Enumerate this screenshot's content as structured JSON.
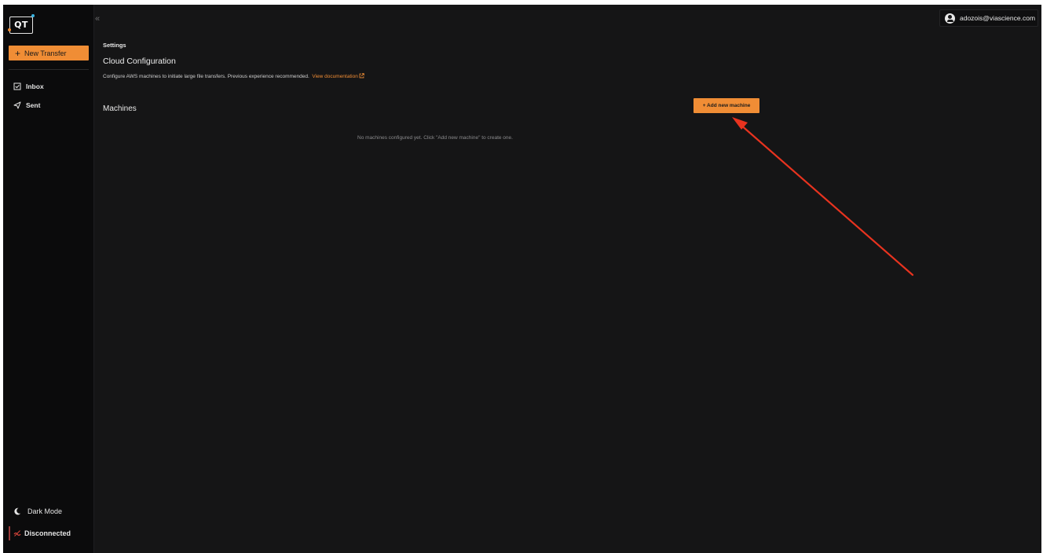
{
  "app": {
    "logo_text": "QT"
  },
  "sidebar": {
    "new_transfer_label": "New Transfer",
    "items": [
      {
        "label": "Inbox",
        "icon": "inbox-icon"
      },
      {
        "label": "Sent",
        "icon": "send-icon"
      }
    ],
    "dark_mode_label": "Dark Mode",
    "connection_status": "Disconnected"
  },
  "header": {
    "collapse_glyph": "«",
    "user_email": "adozois@viascience.com"
  },
  "page": {
    "breadcrumb": "Settings",
    "title": "Cloud Configuration",
    "description": "Configure AWS machines to initiate large file transfers. Previous experience recommended.",
    "doc_link": "View documentation",
    "machines_heading": "Machines",
    "add_machine_label": "+ Add new machine",
    "empty_message": "No machines configured yet. Click \"Add new machine\" to create one."
  },
  "colors": {
    "accent": "#f08d35",
    "background": "#151516",
    "sidebar": "#0b0b0c",
    "annotation_arrow": "#e8331f",
    "disconnected": "#d8453a"
  }
}
